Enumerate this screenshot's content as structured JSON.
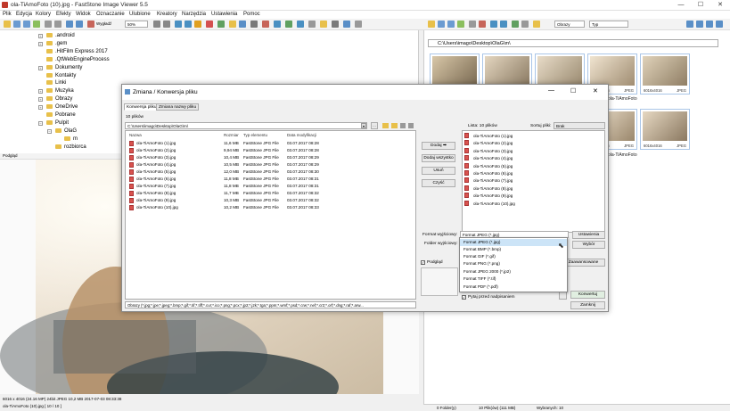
{
  "window": {
    "title": "ola-TiAmoFoto (10).jpg - FastStone Image Viewer 5.5",
    "minimize": "—",
    "maximize": "☐",
    "close": "✕"
  },
  "menu": [
    "Plik",
    "Edycja",
    "Kolory",
    "Efekty",
    "Widok",
    "Oznaczanie",
    "Ulubione",
    "Kreatory",
    "Narzędzia",
    "Ustawienia",
    "Pomoc"
  ],
  "toolbar": {
    "fit_label": "Wygładź",
    "zoom_value": "50%",
    "sort_value": "Obrazy",
    "type_value": "Typ"
  },
  "tree": {
    "items": [
      {
        "label": ".android",
        "indent": 0,
        "expander": "+"
      },
      {
        "label": ".gem",
        "indent": 0,
        "expander": "+"
      },
      {
        "label": ".HitFilm Express 2017",
        "indent": 0,
        "expander": ""
      },
      {
        "label": ".QtWebEngineProcess",
        "indent": 0,
        "expander": ""
      },
      {
        "label": "Dokumenty",
        "indent": 0,
        "expander": "+"
      },
      {
        "label": "Kontakty",
        "indent": 0,
        "expander": ""
      },
      {
        "label": "Linki",
        "indent": 0,
        "expander": ""
      },
      {
        "label": "Muzyka",
        "indent": 0,
        "expander": "+"
      },
      {
        "label": "Obrazy",
        "indent": 0,
        "expander": "+"
      },
      {
        "label": "OneDrive",
        "indent": 0,
        "expander": "+"
      },
      {
        "label": "Pobrane",
        "indent": 0,
        "expander": ""
      },
      {
        "label": "Pulpit",
        "indent": 0,
        "expander": "−"
      },
      {
        "label": "OlaG",
        "indent": 1,
        "expander": "−"
      },
      {
        "label": "m",
        "indent": 2,
        "expander": ""
      },
      {
        "label": "rozbiorca",
        "indent": 1,
        "expander": ""
      }
    ]
  },
  "preview": {
    "label": "Podgląd"
  },
  "status_left": {
    "info": "6016 x 4016 (24.16 MP)  24bit  JPEG   10,2 MB   2017-07-03 08:33:38",
    "file": "ola-TiAmoFoto (10).jpg [ 10 / 10 ]"
  },
  "right": {
    "path": "C:\\Users\\imago\\Desktop\\OlaG\\m\\",
    "thumbs": [
      {
        "res": "6016x4016",
        "fmt": "JPEG"
      },
      {
        "res": "6016x4016",
        "fmt": "JPEG"
      },
      {
        "res": "6016x4016",
        "fmt": "JPEG"
      },
      {
        "res": "6016x4016",
        "fmt": "JPEG"
      },
      {
        "res": "6016x4016",
        "fmt": "JPEG"
      },
      {
        "res": "6016x4016",
        "fmt": "JPEG"
      },
      {
        "res": "6016x4016",
        "fmt": "JPEG"
      }
    ],
    "labels": [
      "ola-TiAmoFoto",
      "ola-TiAmoFoto"
    ],
    "status": {
      "folders": "0 Folder(y)",
      "files": "10 Plik(ów) (111 MB)",
      "selected": "Wybranych: 10"
    }
  },
  "dialog": {
    "title": "Zmiana / Konwersja pliku",
    "tabs": [
      "Konwersja pliku",
      "Zmiana nazwy pliku"
    ],
    "file_count": "10 plików",
    "path": "C:\\Users\\imago\\Desktop\\OlaG\\m\\",
    "columns": [
      "Nazwa",
      "Rozmiar",
      "Typ elementu",
      "Data modyfikacji"
    ],
    "files": [
      {
        "name": "ola-TiAmoFoto (1).jpg",
        "size": "11,6 MB",
        "type": "FastStone JPG File",
        "date": "03.07.2017 08:28"
      },
      {
        "name": "ola-TiAmoFoto (2).jpg",
        "size": "9,94 MB",
        "type": "FastStone JPG File",
        "date": "03.07.2017 08:28"
      },
      {
        "name": "ola-TiAmoFoto (3).jpg",
        "size": "10,4 MB",
        "type": "FastStone JPG File",
        "date": "03.07.2017 08:29"
      },
      {
        "name": "ola-TiAmoFoto (4).jpg",
        "size": "10,5 MB",
        "type": "FastStone JPG File",
        "date": "03.07.2017 08:29"
      },
      {
        "name": "ola-TiAmoFoto (5).jpg",
        "size": "12,0 MB",
        "type": "FastStone JPG File",
        "date": "03.07.2017 08:30"
      },
      {
        "name": "ola-TiAmoFoto (6).jpg",
        "size": "11,8 MB",
        "type": "FastStone JPG File",
        "date": "03.07.2017 08:31"
      },
      {
        "name": "ola-TiAmoFoto (7).jpg",
        "size": "11,8 MB",
        "type": "FastStone JPG File",
        "date": "03.07.2017 08:31"
      },
      {
        "name": "ola-TiAmoFoto (8).jpg",
        "size": "11,7 MB",
        "type": "FastStone JPG File",
        "date": "03.07.2017 08:32"
      },
      {
        "name": "ola-TiAmoFoto (9).jpg",
        "size": "10,3 MB",
        "type": "FastStone JPG File",
        "date": "03.07.2017 08:32"
      },
      {
        "name": "ola-TiAmoFoto (10).jpg",
        "size": "10,2 MB",
        "type": "FastStone JPG File",
        "date": "03.07.2017 08:33"
      }
    ],
    "buttons": {
      "add": "Dodaj ➡",
      "add_all": "Dodaj wszystko",
      "remove": "Usuń",
      "clear": "Czyść"
    },
    "list_label": "Lista: 10 plików",
    "sort_label": "Sortuj pliki:",
    "sort_value": "Brak",
    "right_files": [
      "ola-TiAmoFoto (1).jpg",
      "ola-TiAmoFoto (2).jpg",
      "ola-TiAmoFoto (3).jpg",
      "ola-TiAmoFoto (4).jpg",
      "ola-TiAmoFoto (5).jpg",
      "ola-TiAmoFoto (6).jpg",
      "ola-TiAmoFoto (7).jpg",
      "ola-TiAmoFoto (8).jpg",
      "ola-TiAmoFoto (9).jpg",
      "ola-TiAmoFoto (10).jpg"
    ],
    "format_label": "Format wyjściowy:",
    "format_value": "Format JPEG (*.jpg)",
    "settings_button": "Ustawienia",
    "folder_label": "Folder wyjściowy:",
    "browse_button": "Wybór",
    "advanced_button": "Zaawansowane",
    "preview_check": "Podgląd",
    "format_options": [
      "Format JPEG (*.jpg)",
      "Format BMP (*.bmp)",
      "Format GIF (*.gif)",
      "Format PNG (*.png)",
      "Format JPEG 2000 (*.jp2)",
      "Format TIFF (*.tif)",
      "Format PDF (*.pdf)"
    ],
    "ask_overwrite": "Pytaj przed nadpisaniem",
    "convert_button": "Konwertuj",
    "close_button": "Zamknij",
    "filter": "Obrazy (*.jpg;*.jpe;*.jpeg;*.bmp;*.gif;*.tif;*.tiff;*.cur;*.ico;*.png;*.pcx;*.jp2;*.j2k;*.tga;*.ppm;*.wmf;*.psd;*.crw;*.nef;*.cr2;*.orf;*.dng;*.raf;*.arw..."
  },
  "colors": {
    "accent": "#0078d7",
    "thumb_border": "#aac6e8",
    "selection": "#cce4f7"
  }
}
